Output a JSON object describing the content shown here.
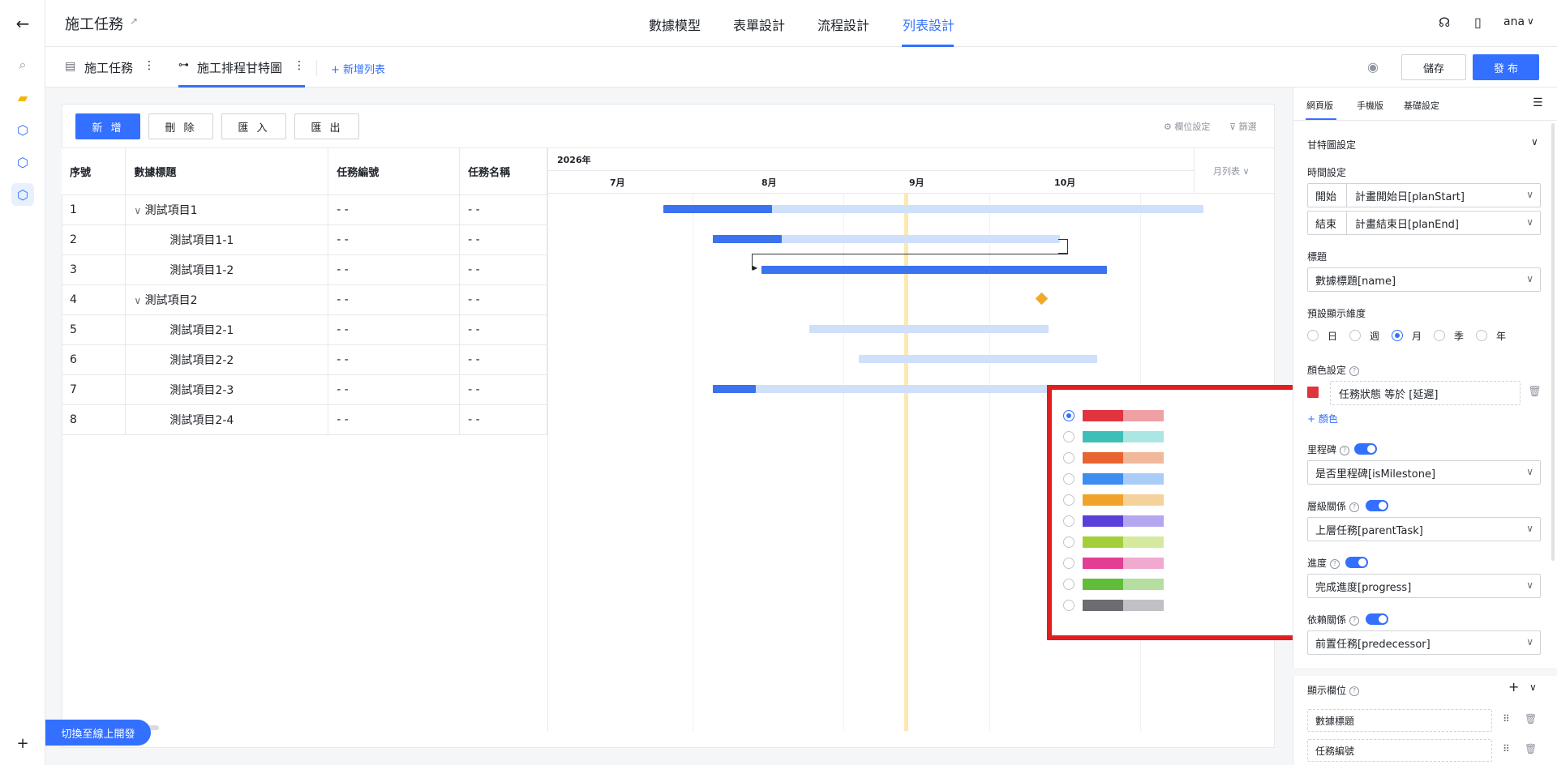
{
  "app": {
    "title": "施工任務",
    "user": "ana"
  },
  "top_tabs": [
    {
      "label": "數據模型",
      "active": false
    },
    {
      "label": "表單設計",
      "active": false
    },
    {
      "label": "流程設計",
      "active": false
    },
    {
      "label": "列表設計",
      "active": true
    }
  ],
  "sub_tabs": [
    {
      "label": "施工任務"
    },
    {
      "label": "施工排程甘特圖",
      "active": true
    }
  ],
  "add_list_label": "+ 新增列表",
  "save_label": "儲存",
  "publish_label": "發 布",
  "toolbar": {
    "add": "新 增",
    "delete": "刪 除",
    "import": "匯 入",
    "export": "匯 出",
    "column_settings": "欄位設定",
    "filter": "篩選"
  },
  "table": {
    "columns": [
      "序號",
      "數據標題",
      "任務編號",
      "任務名稱"
    ],
    "rows": [
      {
        "no": "1",
        "title": "測試項目1",
        "code": "- -",
        "name": "- -"
      },
      {
        "no": "2",
        "title": "測試項目1-1",
        "code": "- -",
        "name": "- -"
      },
      {
        "no": "3",
        "title": "測試項目1-2",
        "code": "- -",
        "name": "- -"
      },
      {
        "no": "4",
        "title": "測試項目2",
        "code": "- -",
        "name": "- -"
      },
      {
        "no": "5",
        "title": "測試項目2-1",
        "code": "- -",
        "name": "- -"
      },
      {
        "no": "6",
        "title": "測試項目2-2",
        "code": "- -",
        "name": "- -"
      },
      {
        "no": "7",
        "title": "測試項目2-3",
        "code": "- -",
        "name": "- -"
      },
      {
        "no": "8",
        "title": "測試項目2-4",
        "code": "- -",
        "name": "- -"
      }
    ]
  },
  "gantt": {
    "year": "2026年",
    "months": [
      "7月",
      "8月",
      "9月",
      "10月"
    ],
    "view_select": "月列表"
  },
  "right_panel": {
    "tabs": [
      "網頁版",
      "手機版",
      "基礎設定"
    ],
    "section_title": "甘特圖設定",
    "time_label": "時間設定",
    "start_label": "開始",
    "start_value": "計畫開始日[planStart]",
    "end_label": "結束",
    "end_value": "計畫結束日[planEnd]",
    "title_label": "標題",
    "title_value": "數據標題[name]",
    "dimension_label": "預設顯示維度",
    "dimensions": [
      "日",
      "週",
      "月",
      "季",
      "年"
    ],
    "color_label": "顏色設定",
    "color_rule": "任務狀態 等於 [延遲]",
    "add_color": "+ 顏色",
    "milestone_label": "里程碑",
    "milestone_value": "是否里程碑[isMilestone]",
    "hierarchy_label": "層級關係",
    "hierarchy_value": "上層任務[parentTask]",
    "progress_label": "進度",
    "progress_value": "完成進度[progress]",
    "dependency_label": "依賴關係",
    "dependency_value": "前置任務[predecessor]",
    "display_fields_label": "顯示欄位",
    "fields": [
      "數據標題",
      "任務編號"
    ]
  },
  "bottom_button": "切換至線上開發",
  "palette": [
    [
      "#e0343f",
      "#f0a0a4"
    ],
    [
      "#3dbfb8",
      "#ace6e2"
    ],
    [
      "#e86430",
      "#f2b89c"
    ],
    [
      "#3d8ef0",
      "#a9cdf6"
    ],
    [
      "#f0a22a",
      "#f5d29b"
    ],
    [
      "#5a3fd9",
      "#b4a7ef"
    ],
    [
      "#a4cf3a",
      "#d5ea9f"
    ],
    [
      "#e33d94",
      "#f1a9cf"
    ],
    [
      "#5fbd3a",
      "#b5dfa1"
    ],
    [
      "#6b6d73",
      "#c0c1c4"
    ]
  ]
}
